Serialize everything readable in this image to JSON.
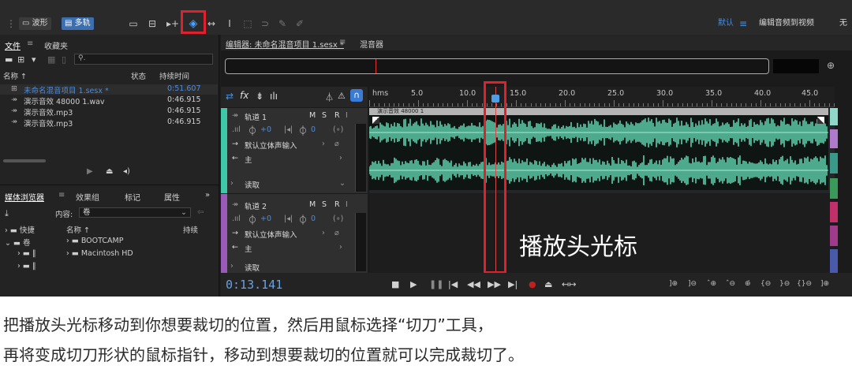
{
  "toolbar": {
    "waveform_label": "波形",
    "multitrack_label": "多轨",
    "workspace_label": "默认",
    "menu_icon": "hamburger-icon",
    "video_edit_label": "编辑音频到视频",
    "tail_label": "无"
  },
  "files_panel": {
    "tab_files": "文件",
    "tab_favorites": "收藏夹",
    "col_name": "名称 ↑",
    "col_status": "状态",
    "col_duration": "持续时间",
    "rows": [
      {
        "name": "未命名混音项目 1.sesx *",
        "duration": "0:51.607",
        "selected": true
      },
      {
        "name": "演示音效 48000 1.wav",
        "duration": "0:46.915",
        "selected": false
      },
      {
        "name": "演示音效.mp3",
        "duration": "0:46.915",
        "selected": false
      },
      {
        "name": "演示音效.mp3",
        "duration": "0:46.915",
        "selected": false
      }
    ]
  },
  "media_panel": {
    "tab_media_browser": "媒体浏览器",
    "tab_effects": "效果组",
    "tab_markers": "标记",
    "tab_properties": "属性",
    "more": "»",
    "content_label": "内容:",
    "content_value": "卷",
    "shortcuts_label": "快捷",
    "col_name": "名称 ↑",
    "col_duration": "持续",
    "tree": [
      {
        "label": "卷"
      },
      {
        "label": "BOOTCAMP"
      },
      {
        "label": "Macintosh HD"
      }
    ]
  },
  "editor": {
    "tab_label": "编辑器: 未命名混音项目 1.sesx *",
    "mixer_label": "混音器",
    "ruler_unit": "hms",
    "ruler_labels": [
      "5.0",
      "10.0",
      "15.0",
      "20.0",
      "25.0",
      "30.0",
      "35.0",
      "40.0",
      "45.0"
    ],
    "clip_label": "演示音效 48000 1",
    "tracks": [
      {
        "name": "轨道 1",
        "m": "M",
        "s": "S",
        "r": "R",
        "i": "I",
        "volume": "+0",
        "pan": "0",
        "input": "默认立体声输入",
        "output": "主",
        "mode": "读取"
      },
      {
        "name": "轨道 2",
        "m": "M",
        "s": "S",
        "r": "R",
        "i": "I",
        "volume": "+0",
        "pan": "0",
        "input": "默认立体声输入",
        "output": "主",
        "mode": "读取"
      }
    ],
    "playhead_callout": "播放头光标",
    "timecode": "0:13.141"
  },
  "caption": {
    "line1": "把播放头光标移动到你想要裁切的位置，然后用鼠标选择“切刀”工具，",
    "line2": "再将变成切刀形状的鼠标指针，移动到想要裁切的位置就可以完成裁切了。"
  },
  "colors": {
    "track1": "#3ec8a8",
    "track2": "#9a5ab8",
    "waveform": "#5fd0ac",
    "highlight": "#e0202d",
    "timecode": "#6aa1e0"
  }
}
